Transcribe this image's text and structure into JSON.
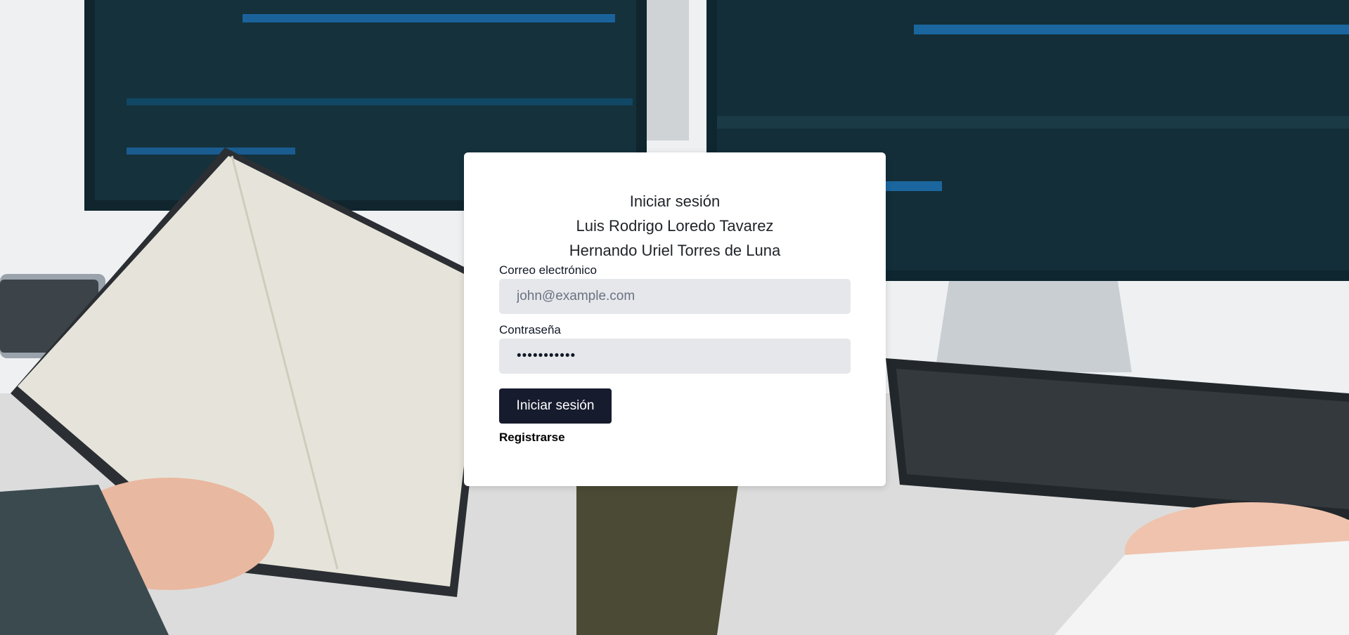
{
  "login": {
    "heading": "Iniciar sesión",
    "author_1": "Luis Rodrigo Loredo Tavarez",
    "author_2": "Hernando Uriel Torres de Luna",
    "email_label": "Correo electrónico",
    "email_placeholder": "john@example.com",
    "password_label": "Contraseña",
    "password_value": "•••••••••••",
    "submit_label": "Iniciar sesión",
    "register_link": "Registrarse"
  },
  "colors": {
    "button_bg": "#171b2e",
    "input_bg": "#e5e7eb",
    "card_bg": "#ffffff"
  }
}
